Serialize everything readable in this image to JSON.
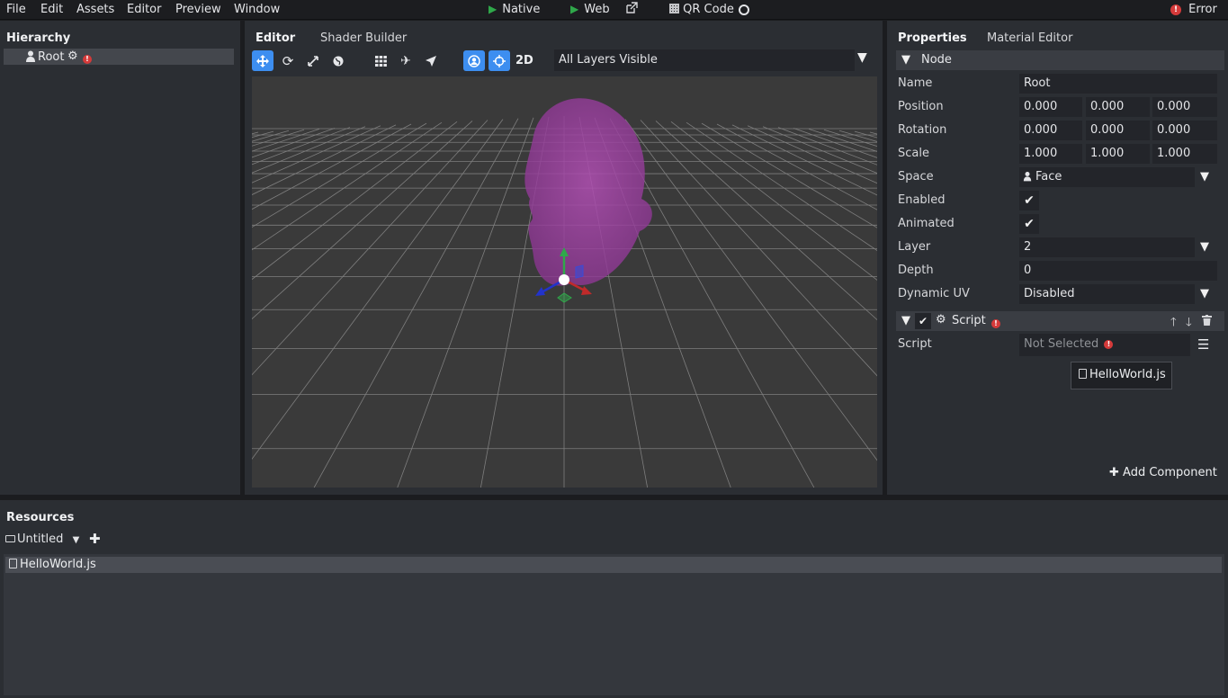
{
  "menubar": {
    "items": [
      "File",
      "Edit",
      "Assets",
      "Editor",
      "Preview",
      "Window"
    ],
    "native_label": "Native",
    "web_label": "Web",
    "qr_label": "QR Code",
    "error_label": "Error"
  },
  "hierarchy": {
    "title": "Hierarchy",
    "root_label": "Root"
  },
  "editor": {
    "tabs": [
      "Editor",
      "Shader Builder"
    ],
    "mode_2d": "2D",
    "layers_value": "All Layers Visible"
  },
  "properties": {
    "tabs": [
      "Properties",
      "Material Editor"
    ],
    "node_header": "Node",
    "name_label": "Name",
    "name_value": "Root",
    "position_label": "Position",
    "position": [
      "0.000",
      "0.000",
      "0.000"
    ],
    "rotation_label": "Rotation",
    "rotation": [
      "0.000",
      "0.000",
      "0.000"
    ],
    "scale_label": "Scale",
    "scale": [
      "1.000",
      "1.000",
      "1.000"
    ],
    "space_label": "Space",
    "space_value": "Face",
    "enabled_label": "Enabled",
    "animated_label": "Animated",
    "layer_label": "Layer",
    "layer_value": "2",
    "depth_label": "Depth",
    "depth_value": "0",
    "dynamic_uv_label": "Dynamic UV",
    "dynamic_uv_value": "Disabled",
    "script_header": "Script",
    "script_label": "Script",
    "script_value": "Not Selected",
    "script_suggestion": "HelloWorld.js",
    "add_component": "Add Component"
  },
  "resources": {
    "title": "Resources",
    "folder": "Untitled",
    "files": [
      "HelloWorld.js"
    ]
  },
  "colors": {
    "accent": "#3d8ef0",
    "error": "#d53a3a",
    "play": "#2fa84a",
    "head": "#9b3e9e"
  }
}
